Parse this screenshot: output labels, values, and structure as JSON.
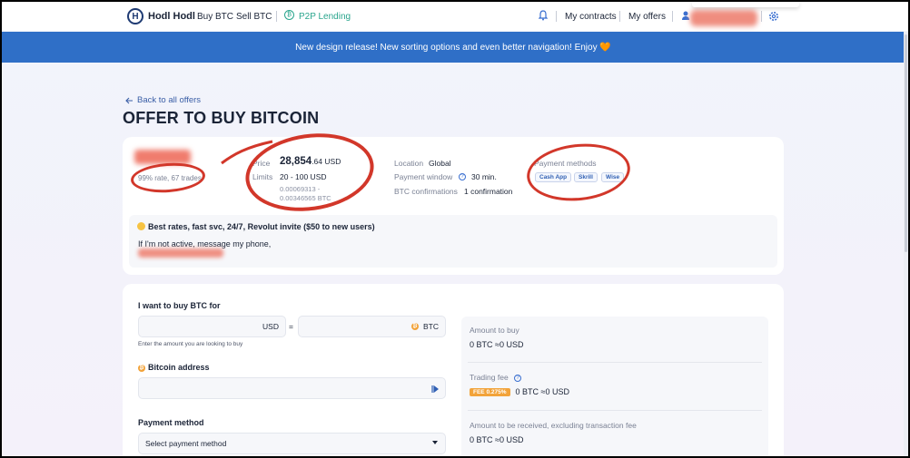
{
  "nav": {
    "logo_letter": "H",
    "brand": "Hodl Hodl",
    "buy": "Buy BTC",
    "sell": "Sell BTC",
    "p2p_icon": "₿",
    "p2p": "P2P Lending",
    "contracts": "My contracts",
    "offers": "My offers",
    "icons": [
      "bell-icon",
      "user-icon",
      "gear-icon"
    ]
  },
  "banner": {
    "text": "New design release! New sorting options and even better navigation! Enjoy 🧡"
  },
  "header": {
    "back": "Back to all offers",
    "title": "OFFER TO BUY BITCOIN"
  },
  "offer": {
    "rate": "99% rate, 67 trades",
    "price_label": "Price",
    "price_main": "28,854",
    "price_decimal": ".64",
    "price_currency": "USD",
    "limits_label": "Limits",
    "limits_value": "20 - 100 USD",
    "btc_range_1": "0.00069313 -",
    "btc_range_2": "0.00346565 BTC",
    "location_label": "Location",
    "location_value": "Global",
    "window_label": "Payment window",
    "window_value": "30 min.",
    "conf_label": "BTC confirmations",
    "conf_value": "1 confirmation",
    "pm_label": "Payment methods",
    "pm": [
      "Cash App",
      "Skrill",
      "Wise"
    ],
    "info_glyph": "?"
  },
  "terms": {
    "title": "Best rates, fast svc, 24/7, Revolut invite ($50 to new users)",
    "body": "If I'm not active, message my phone,"
  },
  "form": {
    "buy_label": "I want to buy BTC for",
    "usd": "USD",
    "equals": "=",
    "btc_glyph": "₿",
    "btc": "BTC",
    "hint": "Enter the amount you are looking to buy",
    "address_label": "Bitcoin address",
    "pm_label": "Payment method",
    "pm_placeholder": "Select payment method"
  },
  "summary": {
    "amount_label": "Amount to buy",
    "amount_value": "0 BTC ≈0 USD",
    "fee_label": "Trading fee",
    "fee_badge": "FEE 0.275%",
    "fee_value": "0 BTC ≈0 USD",
    "received_label": "Amount to be received, excluding transaction fee",
    "received_value": "0 BTC ≈0 USD"
  },
  "colors": {
    "brand_blue": "#2f6fc7",
    "accent_orange": "#f2a33a",
    "annotation_red": "#d2372a",
    "p2p_green": "#2aa58d"
  }
}
